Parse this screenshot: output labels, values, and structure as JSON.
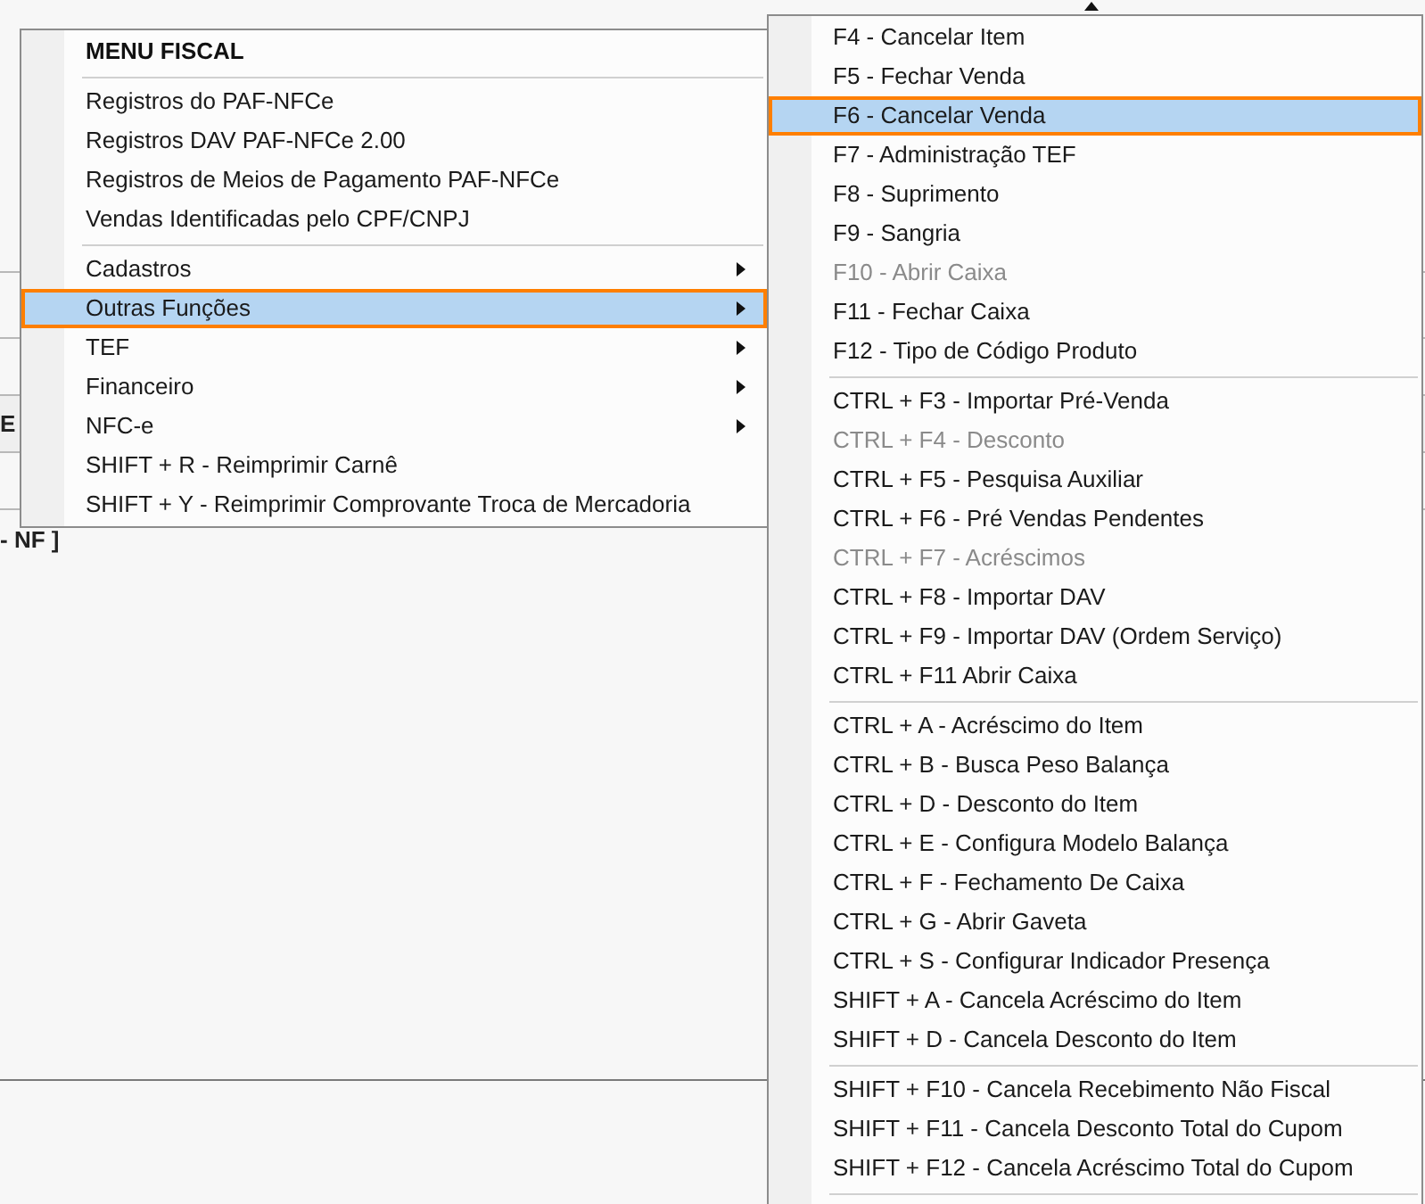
{
  "background": {
    "column_label": "E",
    "section_label": "- NF ]"
  },
  "main_menu": {
    "header": "MENU FISCAL",
    "sections": [
      {
        "items": [
          {
            "label": "Registros do PAF-NFCe",
            "submenu": false,
            "selected": false,
            "disabled": false
          },
          {
            "label": "Registros DAV PAF-NFCe 2.00",
            "submenu": false,
            "selected": false,
            "disabled": false
          },
          {
            "label": "Registros de Meios de Pagamento PAF-NFCe",
            "submenu": false,
            "selected": false,
            "disabled": false
          },
          {
            "label": "Vendas Identificadas pelo CPF/CNPJ",
            "submenu": false,
            "selected": false,
            "disabled": false
          }
        ]
      },
      {
        "items": [
          {
            "label": "Cadastros",
            "submenu": true,
            "selected": false,
            "disabled": false
          },
          {
            "label": "Outras Funções",
            "submenu": true,
            "selected": true,
            "disabled": false
          },
          {
            "label": "TEF",
            "submenu": true,
            "selected": false,
            "disabled": false
          },
          {
            "label": "Financeiro",
            "submenu": true,
            "selected": false,
            "disabled": false
          },
          {
            "label": "NFC-e",
            "submenu": true,
            "selected": false,
            "disabled": false
          },
          {
            "label": "SHIFT + R - Reimprimir Carnê",
            "submenu": false,
            "selected": false,
            "disabled": false
          },
          {
            "label": "SHIFT + Y - Reimprimir Comprovante Troca de Mercadoria",
            "submenu": false,
            "selected": false,
            "disabled": false
          }
        ]
      }
    ]
  },
  "submenu": {
    "sections": [
      {
        "items": [
          {
            "label": "F4 - Cancelar Item",
            "selected": false,
            "disabled": false
          },
          {
            "label": "F5 - Fechar Venda",
            "selected": false,
            "disabled": false
          },
          {
            "label": "F6 - Cancelar Venda",
            "selected": true,
            "disabled": false
          },
          {
            "label": "F7 - Administração TEF",
            "selected": false,
            "disabled": false
          },
          {
            "label": "F8 - Suprimento",
            "selected": false,
            "disabled": false
          },
          {
            "label": "F9 - Sangria",
            "selected": false,
            "disabled": false
          },
          {
            "label": "F10 - Abrir Caixa",
            "selected": false,
            "disabled": true
          },
          {
            "label": "F11 - Fechar Caixa",
            "selected": false,
            "disabled": false
          },
          {
            "label": "F12 - Tipo de Código Produto",
            "selected": false,
            "disabled": false
          }
        ]
      },
      {
        "items": [
          {
            "label": "CTRL + F3 - Importar Pré-Venda",
            "selected": false,
            "disabled": false
          },
          {
            "label": "CTRL + F4 - Desconto",
            "selected": false,
            "disabled": true
          },
          {
            "label": "CTRL + F5 - Pesquisa Auxiliar",
            "selected": false,
            "disabled": false
          },
          {
            "label": "CTRL + F6 - Pré Vendas Pendentes",
            "selected": false,
            "disabled": false
          },
          {
            "label": "CTRL + F7 - Acréscimos",
            "selected": false,
            "disabled": true
          },
          {
            "label": "CTRL + F8 - Importar DAV",
            "selected": false,
            "disabled": false
          },
          {
            "label": "CTRL + F9 - Importar DAV (Ordem Serviço)",
            "selected": false,
            "disabled": false
          },
          {
            "label": "CTRL + F11 Abrir Caixa",
            "selected": false,
            "disabled": false
          }
        ]
      },
      {
        "items": [
          {
            "label": "CTRL + A - Acréscimo do Item",
            "selected": false,
            "disabled": false
          },
          {
            "label": "CTRL + B - Busca Peso Balança",
            "selected": false,
            "disabled": false
          },
          {
            "label": "CTRL + D - Desconto do Item",
            "selected": false,
            "disabled": false
          },
          {
            "label": "CTRL + E - Configura Modelo Balança",
            "selected": false,
            "disabled": false
          },
          {
            "label": "CTRL + F - Fechamento De Caixa",
            "selected": false,
            "disabled": false
          },
          {
            "label": "CTRL + G - Abrir Gaveta",
            "selected": false,
            "disabled": false
          },
          {
            "label": "CTRL + S - Configurar Indicador Presença",
            "selected": false,
            "disabled": false
          },
          {
            "label": "SHIFT + A - Cancela Acréscimo do Item",
            "selected": false,
            "disabled": false
          },
          {
            "label": "SHIFT + D - Cancela Desconto do Item",
            "selected": false,
            "disabled": false
          }
        ]
      },
      {
        "items": [
          {
            "label": "SHIFT + F10 - Cancela Recebimento Não Fiscal",
            "selected": false,
            "disabled": false
          },
          {
            "label": "SHIFT + F11 - Cancela Desconto Total do Cupom",
            "selected": false,
            "disabled": false
          },
          {
            "label": "SHIFT + F12 - Cancela Acréscimo Total do Cupom",
            "selected": false,
            "disabled": false
          }
        ]
      }
    ]
  }
}
